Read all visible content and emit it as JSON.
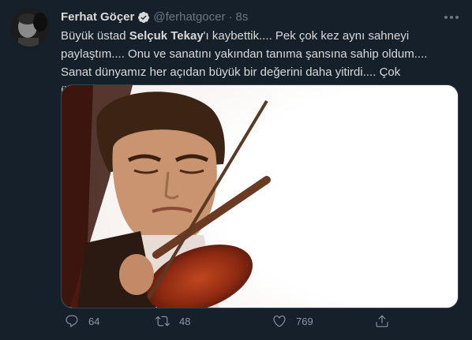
{
  "author": {
    "display_name": "Ferhat Göçer",
    "handle": "@ferhatgocer",
    "separator": "·",
    "time": "8s"
  },
  "tweet": {
    "text_part1": "Büyük üstad ",
    "mention": "Selçuk Tekay",
    "text_part2": "'ı kaybettik....  Pek çok kez  aynı sahneyi paylaştım.... Onu  ve sanatını yakından tanıma şansına sahip oldum.... Sanat dünyamız her açıdan büyük bir değerini daha yitirdi.... Çok üzgünüm..."
  },
  "actions": {
    "reply_count": "64",
    "retweet_count": "48",
    "like_count": "769"
  },
  "icons": {
    "verified": "verified-badge-icon",
    "more": "more-options-icon",
    "reply": "reply-icon",
    "retweet": "retweet-icon",
    "like": "heart-icon",
    "share": "share-icon"
  },
  "colors": {
    "background": "#15202b",
    "text": "#d9d9d9",
    "muted": "#6e767d",
    "verified": "#d9d9d9"
  }
}
